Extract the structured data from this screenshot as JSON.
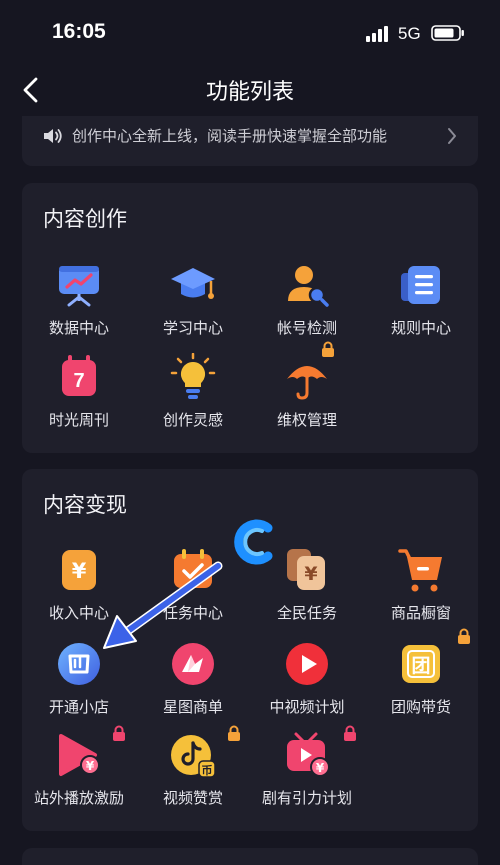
{
  "status_bar": {
    "time": "16:05",
    "network": "5G"
  },
  "nav": {
    "title": "功能列表"
  },
  "notice": {
    "text": "创作中心全新上线，阅读手册快速掌握全部功能"
  },
  "content_creation": {
    "title": "内容创作",
    "items": [
      {
        "label": "数据中心",
        "icon": "chart-board-icon"
      },
      {
        "label": "学习中心",
        "icon": "graduation-cap-icon"
      },
      {
        "label": "帐号检测",
        "icon": "user-search-icon"
      },
      {
        "label": "规则中心",
        "icon": "rules-book-icon"
      },
      {
        "label": "时光周刊",
        "icon": "calendar-7-icon",
        "badge": "7"
      },
      {
        "label": "创作灵感",
        "icon": "lightbulb-icon"
      },
      {
        "label": "维权管理",
        "icon": "umbrella-icon"
      }
    ]
  },
  "content_monetization": {
    "title": "内容变现",
    "items": [
      {
        "label": "收入中心",
        "icon": "yuan-wallet-icon"
      },
      {
        "label": "任务中心",
        "icon": "task-calendar-icon"
      },
      {
        "label": "全民任务",
        "icon": "stacked-yuan-icon"
      },
      {
        "label": "商品橱窗",
        "icon": "shopping-cart-icon"
      },
      {
        "label": "开通小店",
        "icon": "shop-icon"
      },
      {
        "label": "星图商单",
        "icon": "star-map-icon"
      },
      {
        "label": "中视频计划",
        "icon": "play-video-icon"
      },
      {
        "label": "团购带货",
        "icon": "group-buy-icon",
        "badge": "团"
      },
      {
        "label": "站外播放激励",
        "icon": "offsite-play-icon"
      },
      {
        "label": "视频赞赏",
        "icon": "douyin-coin-icon"
      },
      {
        "label": "剧有引力计划",
        "icon": "drama-play-icon"
      }
    ]
  },
  "colors": {
    "background": "#161621",
    "card": "#1f1f2b",
    "accent_orange": "#f5a23a",
    "accent_blue": "#4a7df0",
    "accent_pink": "#f0456e"
  }
}
